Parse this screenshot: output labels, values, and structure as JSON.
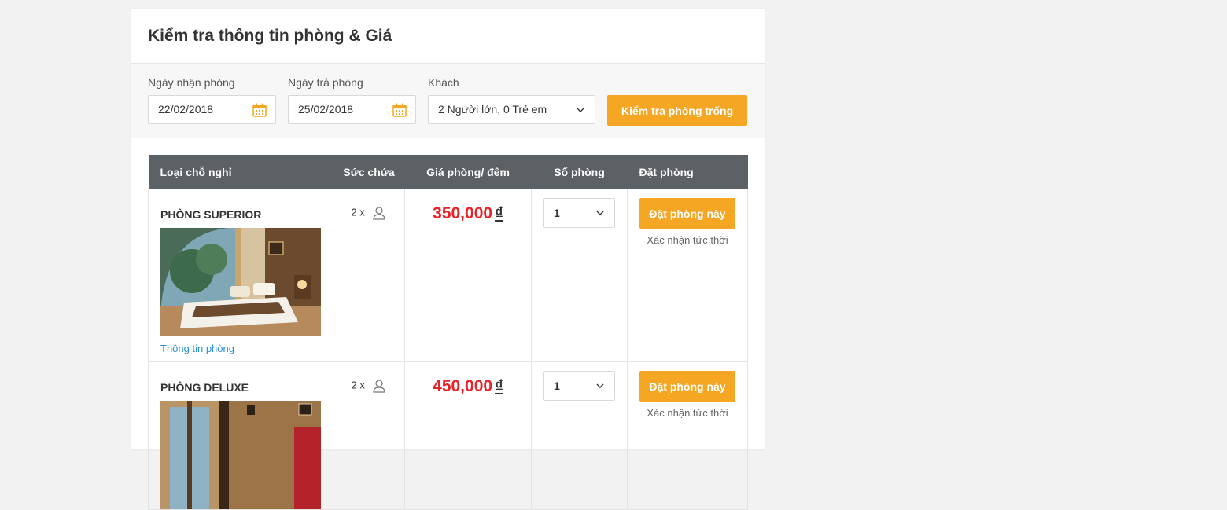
{
  "page": {
    "title": "Kiểm tra thông tin phòng & Giá"
  },
  "search": {
    "checkin_label": "Ngày nhận phòng",
    "checkin_value": "22/02/2018",
    "checkout_label": "Ngày trả phòng",
    "checkout_value": "25/02/2018",
    "guests_label": "Khách",
    "guests_value": "2 Người lớn, 0 Trẻ em",
    "button_label": "Kiểm tra phòng trống"
  },
  "table": {
    "headers": [
      "Loại chỗ nghỉ",
      "Sức chứa",
      "Giá phòng/ đêm",
      "Số phòng",
      "Đặt phòng"
    ],
    "rows": [
      {
        "name": "PHÒNG SUPERIOR",
        "capacity": "2 x",
        "price": "350,000",
        "currency": "₫",
        "quantity": "1",
        "book_label": "Đặt phòng này",
        "book_note": "Xác nhận tức thời",
        "info_link": "Thông tin phòng"
      },
      {
        "name": "PHÒNG DELUXE",
        "capacity": "2 x",
        "price": "450,000",
        "currency": "₫",
        "quantity": "1",
        "book_label": "Đặt phòng này",
        "book_note": "Xác nhận tức thời"
      }
    ]
  },
  "colors": {
    "accent": "#f5a623",
    "header_bg": "#5c6166",
    "price": "#e8232a",
    "link": "#2a8fd6"
  },
  "icons": {
    "date": "calendar-icon",
    "dropdown": "chevron-down-icon",
    "capacity": "person-icon"
  }
}
